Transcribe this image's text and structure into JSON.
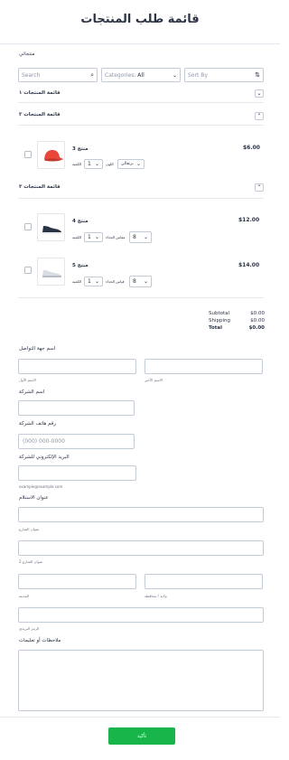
{
  "form": {
    "title": "قائمة طلب المنتجات",
    "products_label": "منتجاتي",
    "search_placeholder": "Search",
    "categories_label": "Categories:",
    "categories_value": "All",
    "sort_placeholder": "Sort By"
  },
  "sections": [
    {
      "title": "قائمة المنتجات ١",
      "expanded": false,
      "toggle": "⌄"
    },
    {
      "title": "قائمة المنتجات ٢",
      "expanded": true,
      "toggle": "⌃"
    },
    {
      "title": "قائمة المنتجات ٣",
      "expanded": true,
      "toggle": "⌃"
    }
  ],
  "products": [
    {
      "name": "منتج 3",
      "price": "$6.00",
      "qty": "1",
      "qty_label": "الكمية",
      "opt_label": "اللون",
      "opt_value": "برتقالي",
      "icon": "cap-icon",
      "color": "#e8473a"
    },
    {
      "name": "منتج 4",
      "price": "$12.00",
      "qty": "1",
      "qty_label": "الكمية",
      "opt_label": "مقاس الحذاء",
      "opt_value": "8",
      "icon": "sneaker-dark-icon",
      "color": "#2a3345"
    },
    {
      "name": "منتج 5",
      "price": "$14.00",
      "qty": "1",
      "qty_label": "الكمية",
      "opt_label": "قياس الحذاء",
      "opt_value": "8",
      "icon": "sneaker-white-icon",
      "color": "#d9dde3"
    }
  ],
  "totals": {
    "subtotal_label": "Subtotal",
    "subtotal_value": "$0.00",
    "shipping_label": "Shipping",
    "shipping_value": "$0.00",
    "total_label": "Total",
    "total_value": "$0.00"
  },
  "contact": {
    "name_label": "اسم جهة التواصل",
    "first_sub": "الاسم الأول",
    "last_sub": "الاسم الأخير",
    "company_label": "اسم الشركة",
    "phone_label": "رقم هاتف الشركة",
    "phone_placeholder": "(000) 000-0000",
    "email_label": "البريد الإلكتروني للشركة",
    "email_sub": "example@example.com",
    "address_label": "عنوان الاستلام",
    "street_sub": "عنوان الشارع",
    "street2_sub": "عنوان الشارع 2",
    "city_sub": "المدينة",
    "state_sub": "ولاية / محافظة",
    "zip_sub": "الرمز البريدي",
    "notes_label": "ملاحظات أو تعليمات"
  },
  "submit_label": "تأكيد"
}
